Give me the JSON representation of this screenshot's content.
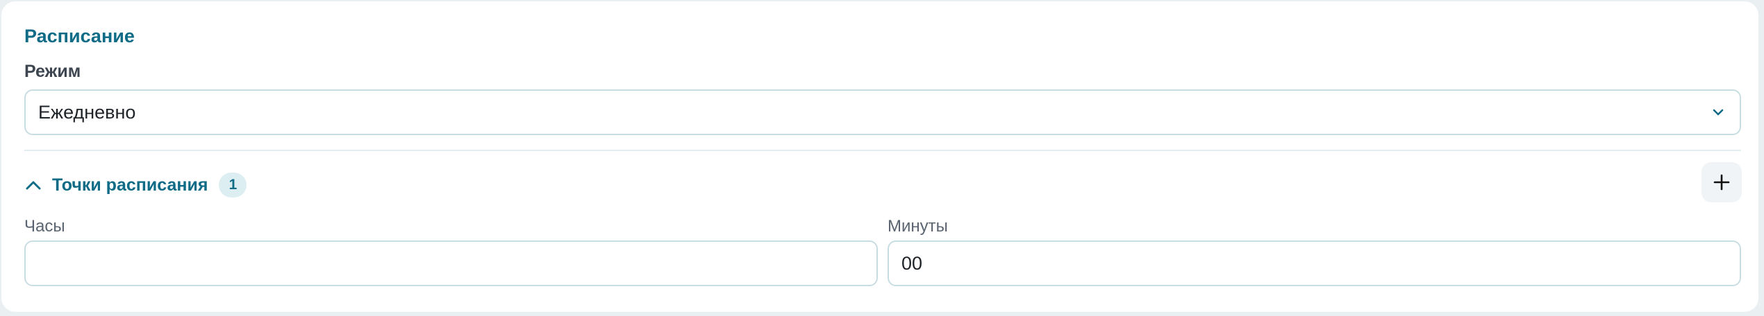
{
  "schedule": {
    "title": "Расписание",
    "mode": {
      "label": "Режим",
      "selected": "Ежедневно",
      "icon": "chevron-down-icon"
    },
    "points": {
      "title": "Точки расписания",
      "count": "1",
      "expanded": true,
      "collapse_icon": "chevron-up-icon",
      "add_icon": "plus-icon"
    },
    "hours": {
      "label": "Часы",
      "value": ""
    },
    "minutes": {
      "label": "Минуты",
      "value": "00"
    }
  },
  "colors": {
    "accent": "#0f6b86",
    "border": "#c8dde2",
    "badge_bg": "#ddeef2",
    "background": "#eaf0f2"
  }
}
